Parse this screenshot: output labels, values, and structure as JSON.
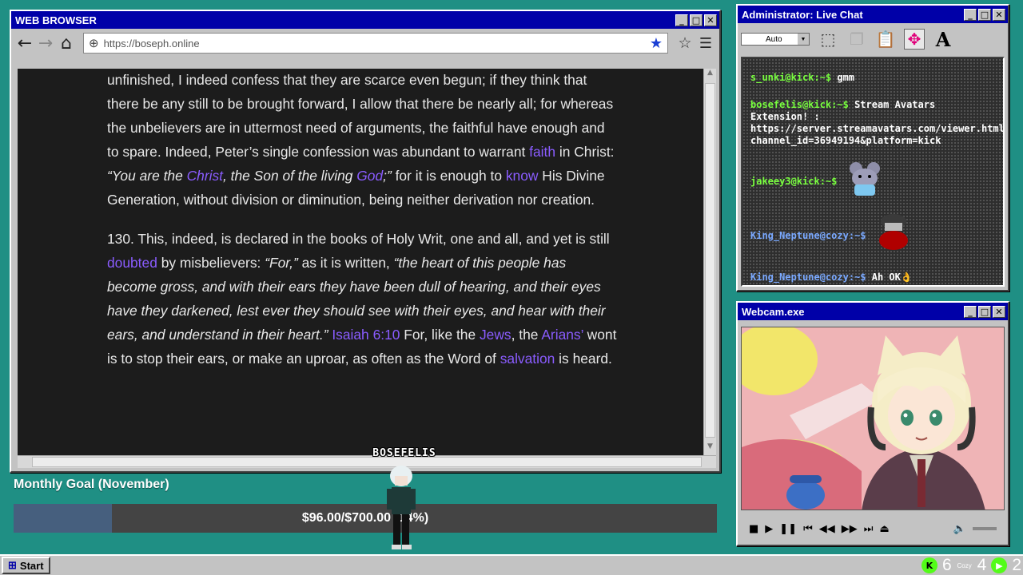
{
  "browser": {
    "title": "WEB BROWSER",
    "url": "https://boseph.online",
    "paragraphs": [
      [
        {
          "t": "unfinished, I indeed confess that they are scarce even begun; if they think that there be any still to be brought forward, I allow that there be nearly all; for whereas the unbelievers are in uttermost need of arguments, the faithful have enough and to spare. Indeed, Peter’s single confession was abundant to warrant "
        },
        {
          "t": "faith",
          "link": true
        },
        {
          "t": " in Christ: "
        },
        {
          "t": "“You are the ",
          "i": true
        },
        {
          "t": "Christ",
          "i": true,
          "link": true
        },
        {
          "t": ", the Son of the living ",
          "i": true
        },
        {
          "t": "God",
          "i": true,
          "link": true
        },
        {
          "t": ";”",
          "i": true
        },
        {
          "t": " for it is enough to "
        },
        {
          "t": "know",
          "link": true
        },
        {
          "t": " His Divine Generation, without division or diminution, being neither derivation nor creation."
        }
      ],
      [
        {
          "t": "130. This, indeed, is declared in the books of Holy Writ, one and all, and yet is still "
        },
        {
          "t": "doubted",
          "link": true
        },
        {
          "t": " by misbelievers: "
        },
        {
          "t": "“For,”",
          "i": true
        },
        {
          "t": " as it is written, "
        },
        {
          "t": "“the heart of this people has become gross, and with their ears they have been dull of hearing, and their eyes have they darkened, lest ever they should see with their eyes, and hear with their ears, and understand in their heart.”",
          "i": true
        },
        {
          "t": " "
        },
        {
          "t": "Isaiah 6:10",
          "link": true
        },
        {
          "t": " For, like the "
        },
        {
          "t": "Jews",
          "link": true
        },
        {
          "t": ", the "
        },
        {
          "t": "Arians’",
          "link": true
        },
        {
          "t": " wont is to stop their ears, or make an uproar, as often as the Word of "
        },
        {
          "t": "salvation",
          "link": true
        },
        {
          "t": " is heard."
        }
      ]
    ]
  },
  "chat": {
    "title": "Administrator: Live Chat",
    "select_value": "Auto",
    "messages": [
      {
        "user": "s_unki@kick:~$",
        "text": "gmm",
        "color": "green"
      },
      {
        "user": "bosefelis@kick:~$",
        "text": "Stream Avatars Extension! : https://server.streamavatars.com/viewer.html?channel_id=36949194&platform=kick",
        "color": "green"
      },
      {
        "user": "jakeey3@kick:~$",
        "text": "",
        "color": "green"
      },
      {
        "user": "King_Neptune@cozy:~$",
        "text": "",
        "color": "blue"
      },
      {
        "user": "King_Neptune@cozy:~$",
        "text": "Ah OK👌",
        "color": "blue"
      }
    ]
  },
  "webcam": {
    "title": "Webcam.exe"
  },
  "goal": {
    "label": "Monthly Goal (November)",
    "text": "$96.00/$700.00 (14%)",
    "fraction": 0.14
  },
  "sprite": {
    "name": "BOSEFELIS"
  },
  "taskbar": {
    "start": "Start",
    "kick_count": "6",
    "cozy_label": "Cozy",
    "cozy_count": "4",
    "other_count": "2"
  },
  "colors": {
    "desktop": "#1f8f84",
    "titlebar": "#0000a8",
    "link": "#8a5cff",
    "chat_user_green": "#79ff3f",
    "chat_user_blue": "#7aa9ff",
    "goal_fill": "#465f7e",
    "kick_green": "#53fc18"
  }
}
